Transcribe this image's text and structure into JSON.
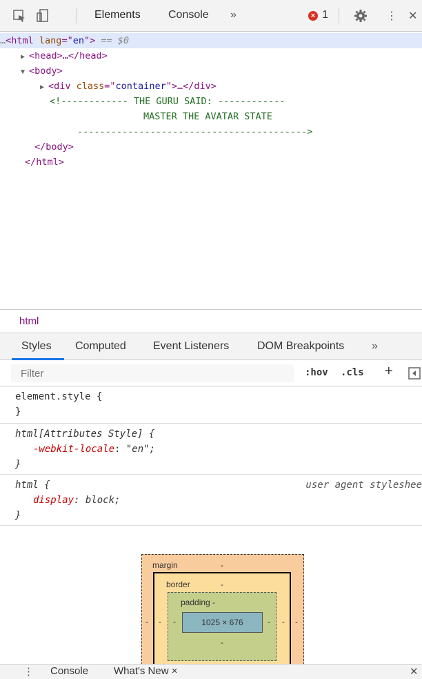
{
  "toolbar": {
    "tabs": [
      "Elements",
      "Console"
    ],
    "more": "»",
    "error_count": "1",
    "close": "✕",
    "menu": "⋮"
  },
  "dom": {
    "selected_line": {
      "prefix": "…",
      "open": "<html ",
      "attr": "lang",
      "eq": "=\"",
      "val": "en",
      "close": "\">",
      "marker": " == $0"
    },
    "head": "<head>…</head>",
    "body_open": "<body>",
    "div": {
      "open": "<div ",
      "attr": "class",
      "eq": "=\"",
      "val": "container",
      "close": "\">…</div>"
    },
    "comment_1": "<!------------ THE GURU SAID: ------------",
    "comment_2": "MASTER THE AVATAR STATE",
    "comment_3": "----------------------------------------->",
    "body_close": "</body>",
    "html_close": "</html>"
  },
  "breadcrumb": {
    "item": "html"
  },
  "styles_tabs": [
    "Styles",
    "Computed",
    "Event Listeners",
    "DOM Breakpoints",
    "»"
  ],
  "filter": {
    "placeholder": "Filter",
    "hov": ":hov",
    "cls": ".cls",
    "plus": "+"
  },
  "rules": {
    "element_style": {
      "selector": "element.style {",
      "close": "}"
    },
    "attr_style": {
      "selector": "html[Attributes Style] {",
      "prop": "-webkit-locale",
      "value": "\"en\";",
      "close": "}"
    },
    "ua": {
      "selector": "html {",
      "source": "user agent styleshee",
      "prop": "display",
      "value": "block;",
      "close": "}"
    }
  },
  "box_model": {
    "margin_label": "margin",
    "margin_val": "-",
    "border_label": "border",
    "border_val": "-",
    "padding_label": "padding -",
    "content": "1025 × 676",
    "dash": "-"
  },
  "drawer": {
    "menu": "⋮",
    "tabs": [
      "Console",
      "What's New ×"
    ],
    "close": "✕"
  }
}
